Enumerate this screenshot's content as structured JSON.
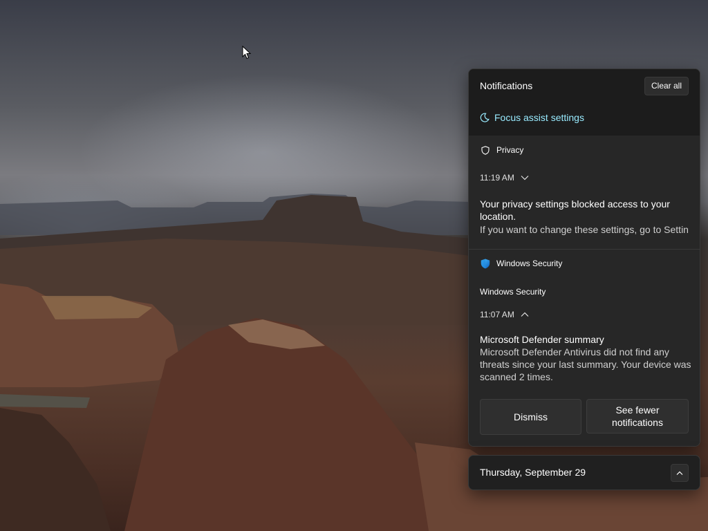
{
  "notification_center": {
    "title": "Notifications",
    "clear_all_label": "Clear all",
    "focus_assist_label": "Focus assist settings",
    "accent_color": "#99ebff"
  },
  "privacy_group": {
    "app_name": "Privacy",
    "app_icon": "shield-outline-icon",
    "time": "11:19 AM",
    "expanded": false,
    "title": "Your privacy settings blocked access to your location.",
    "body": "If you want to change these settings, go to Settin"
  },
  "security_group": {
    "app_name": "Windows Security",
    "app_icon": "windows-security-shield-icon",
    "sender": "Windows Security",
    "time": "11:07 AM",
    "expanded": true,
    "title": "Microsoft Defender summary",
    "body": "Microsoft Defender Antivirus did not find any threats since your last summary. Your device was scanned 2 times.",
    "buttons": {
      "dismiss": "Dismiss",
      "see_fewer": "See fewer notifications"
    }
  },
  "calendar": {
    "date": "Thursday, September 29",
    "toggle_icon": "chevron-up-icon"
  }
}
